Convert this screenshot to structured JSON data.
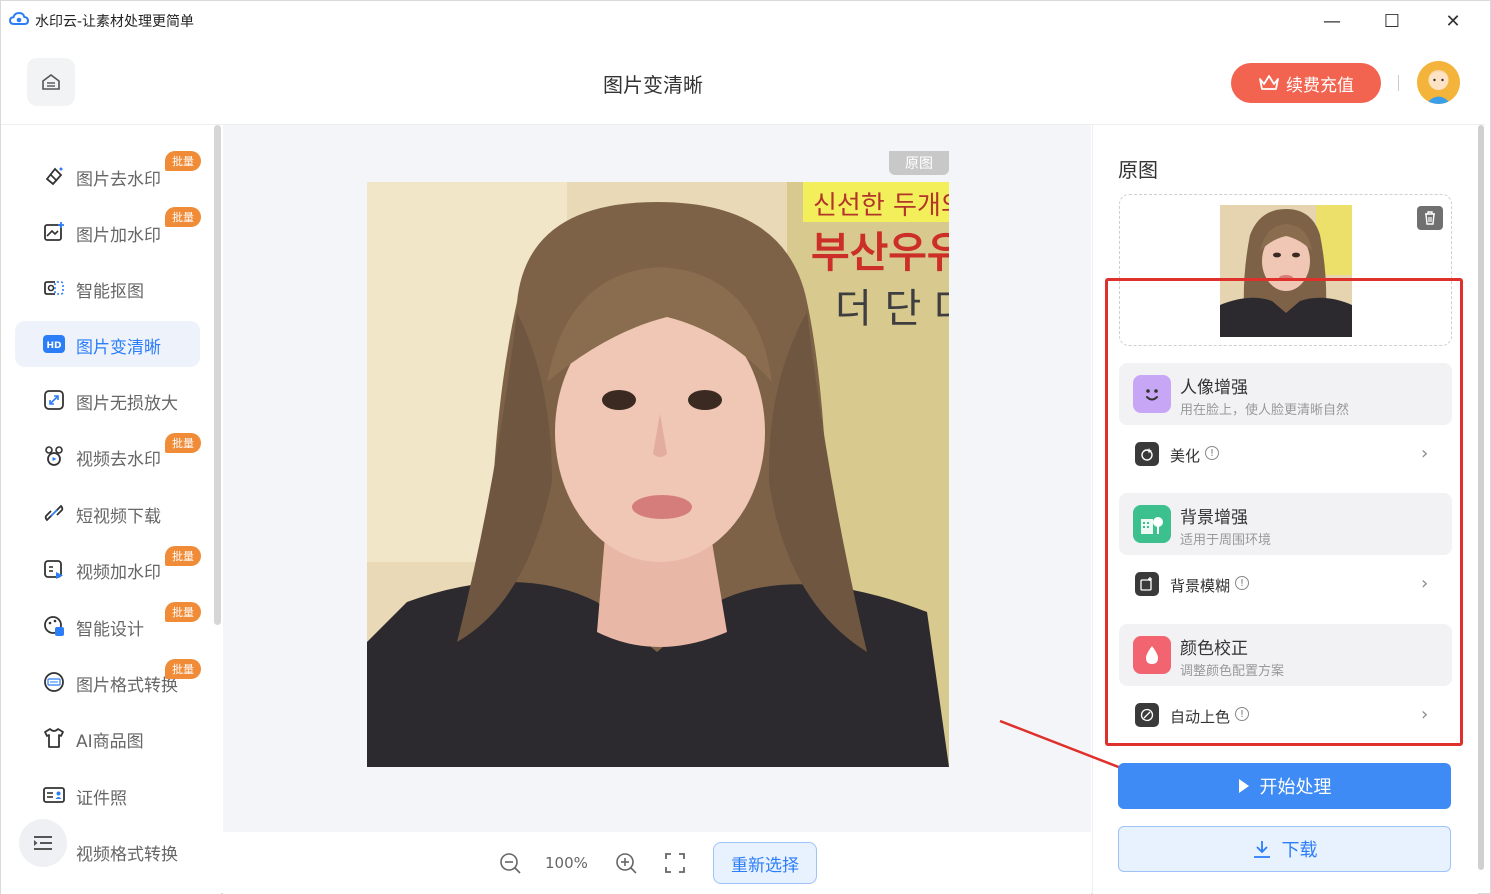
{
  "window": {
    "title": "水印云-让素材处理更简单",
    "minimize": "—",
    "maximize": "☐",
    "close": "✕"
  },
  "header": {
    "page_title": "图片变清晰",
    "vip_button": "续费充值"
  },
  "sidebar": {
    "items": [
      {
        "label": "图片去水印",
        "icon": "eraser-icon",
        "badge": "批量"
      },
      {
        "label": "图片加水印",
        "icon": "image-add-icon",
        "badge": "批量"
      },
      {
        "label": "智能抠图",
        "icon": "cutout-icon",
        "badge": ""
      },
      {
        "label": "图片变清晰",
        "icon": "hd-icon",
        "badge": "",
        "active": true
      },
      {
        "label": "图片无损放大",
        "icon": "expand-icon",
        "badge": ""
      },
      {
        "label": "视频去水印",
        "icon": "video-eraser-icon",
        "badge": "批量"
      },
      {
        "label": "短视频下载",
        "icon": "link-icon",
        "badge": ""
      },
      {
        "label": "视频加水印",
        "icon": "video-add-icon",
        "badge": "批量"
      },
      {
        "label": "智能设计",
        "icon": "design-icon",
        "badge": "批量"
      },
      {
        "label": "图片格式转换",
        "icon": "jpg-convert-icon",
        "badge": "批量"
      },
      {
        "label": "AI商品图",
        "icon": "shirt-icon",
        "badge": ""
      },
      {
        "label": "证件照",
        "icon": "id-card-icon",
        "badge": ""
      },
      {
        "label": "视频格式转换",
        "icon": "video-convert-icon",
        "badge": ""
      }
    ],
    "hd_glyph": "HD"
  },
  "canvas": {
    "original_tag": "原图",
    "photo_sign_text_1": "신선한 두개의 일등",
    "photo_sign_text_2": "부산우유",
    "photo_sign_text_3": "더 단 다",
    "zoom_level": "100%",
    "reselect_button": "重新选择"
  },
  "panel": {
    "title": "原图",
    "features": [
      {
        "title": "人像增强",
        "desc": "用在脸上，使人脸更清晰自然",
        "option": "美化",
        "icon_color": "#c7a6f5"
      },
      {
        "title": "背景增强",
        "desc": "适用于周围环境",
        "option": "背景模糊",
        "icon_color": "#3cc08e"
      },
      {
        "title": "颜色校正",
        "desc": "调整颜色配置方案",
        "option": "自动上色",
        "icon_color": "#f26470"
      }
    ],
    "info_glyph": "!",
    "start_button": "开始处理",
    "download_button": "下载"
  },
  "colors": {
    "accent": "#2c7ef8",
    "vip": "#f26450",
    "badge": "#f08b38",
    "highlight": "#e0302c"
  }
}
